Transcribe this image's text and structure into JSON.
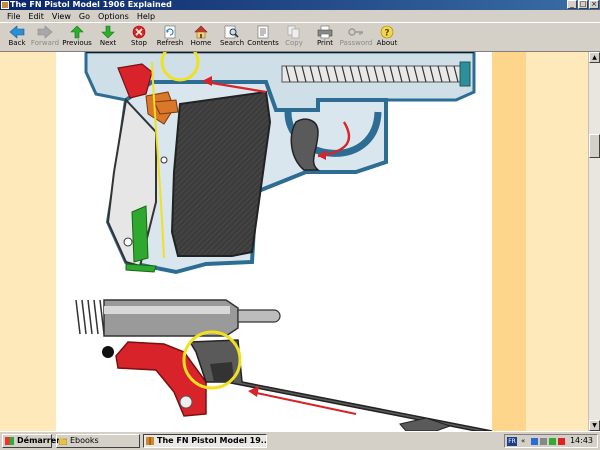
{
  "window": {
    "title": "The FN Pistol Model 1906 Explained"
  },
  "menu": [
    "File",
    "Edit",
    "View",
    "Go",
    "Options",
    "Help"
  ],
  "toolbar": [
    {
      "label": "Back",
      "icon": "back-arrow-icon",
      "enabled": true
    },
    {
      "label": "Forward",
      "icon": "forward-arrow-icon",
      "enabled": false
    },
    {
      "label": "Previous",
      "icon": "up-arrow-icon",
      "enabled": true
    },
    {
      "label": "Next",
      "icon": "down-arrow-icon",
      "enabled": true
    },
    {
      "label": "Stop",
      "icon": "stop-icon",
      "enabled": true
    },
    {
      "label": "Refresh",
      "icon": "refresh-icon",
      "enabled": true
    },
    {
      "label": "Home",
      "icon": "home-icon",
      "enabled": true
    },
    {
      "label": "Search",
      "icon": "search-icon",
      "enabled": true
    },
    {
      "label": "Contents",
      "icon": "contents-icon",
      "enabled": true
    },
    {
      "label": "Copy",
      "icon": "copy-icon",
      "enabled": false
    },
    {
      "label": "Print",
      "icon": "print-icon",
      "enabled": true
    },
    {
      "label": "Password",
      "icon": "key-icon",
      "enabled": false
    },
    {
      "label": "About",
      "icon": "about-icon",
      "enabled": true
    }
  ],
  "taskbar": {
    "start_label": "Démarrer",
    "tasks": [
      {
        "label": "Ebooks",
        "active": false
      },
      {
        "label": "The FN Pistol Model 19...",
        "active": true
      }
    ],
    "tray_lang": "FR",
    "clock": "14:43"
  },
  "colors": {
    "title_bar": "#0a246a",
    "page_background": "#fde9ba",
    "band": "#fdd68c",
    "frame_blue": "#2e6d93",
    "grip_gray": "#3c3c3c",
    "part_red": "#d8232a",
    "part_orange": "#d9772a",
    "highlight_yellow": "#f0e020",
    "part_green": "#2fa82f"
  }
}
